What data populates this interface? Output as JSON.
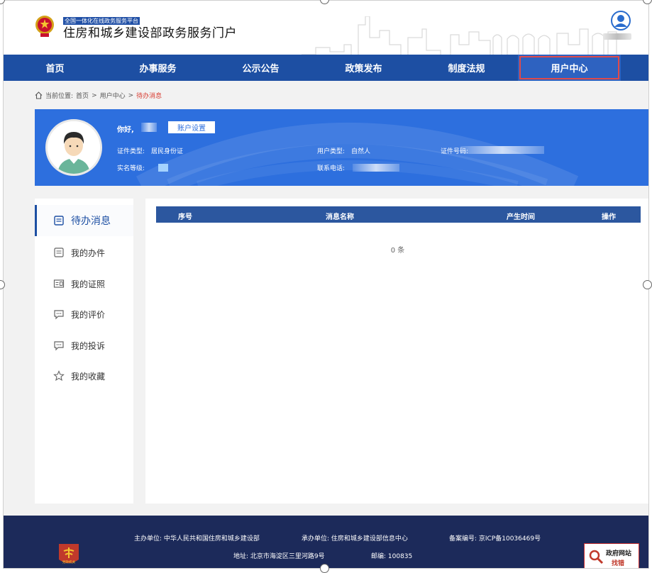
{
  "header": {
    "small_title": "全国一体化在线政务服务平台",
    "main_title": "住房和城乡建设部政务服务门户"
  },
  "nav": {
    "items": [
      "首页",
      "办事服务",
      "公示公告",
      "政策发布",
      "制度法规",
      "用户中心"
    ],
    "active": "用户中心"
  },
  "breadcrumb": {
    "prefix": "当前位置:",
    "home": "首页",
    "sep1": ">",
    "level2": "用户中心",
    "sep2": ">",
    "current": "待办消息"
  },
  "profile": {
    "greeting": "你好,",
    "account_button": "账户设置",
    "id_type_label": "证件类型:",
    "id_type_value": "居民身份证",
    "realname_label": "实名等级:",
    "user_type_label": "用户类型:",
    "user_type_value": "自然人",
    "phone_label": "联系电话:",
    "id_number_label": "证件号码:"
  },
  "sidebar": {
    "items": [
      {
        "label": "待办消息",
        "icon": "message-icon",
        "active": true
      },
      {
        "label": "我的办件",
        "icon": "document-icon",
        "active": false
      },
      {
        "label": "我的证照",
        "icon": "id-card-icon",
        "active": false
      },
      {
        "label": "我的评价",
        "icon": "comment-icon",
        "active": false
      },
      {
        "label": "我的投诉",
        "icon": "comment-icon",
        "active": false
      },
      {
        "label": "我的收藏",
        "icon": "star-icon",
        "active": false
      }
    ]
  },
  "table": {
    "columns": [
      "序号",
      "消息名称",
      "产生时间",
      "操作"
    ],
    "empty_text": "0 条"
  },
  "footer": {
    "host": "主办单位: 中华人民共和国住房和城乡建设部",
    "undertaker": "承办单位: 住房和城乡建设部信息中心",
    "icp": "备案编号: 京ICP备10036469号",
    "address": "地址: 北京市海淀区三里河路9号",
    "postcode": "邮编: 100835",
    "error_badge_line1": "政府网站",
    "error_badge_line2": "找错",
    "party_logo_text": "党政机关"
  },
  "colors": {
    "nav_bg": "#1d4fa3",
    "banner_bg": "#2d6fde",
    "table_head": "#2c579f",
    "footer_bg": "#1c2a5a",
    "highlight": "#d83b30"
  }
}
